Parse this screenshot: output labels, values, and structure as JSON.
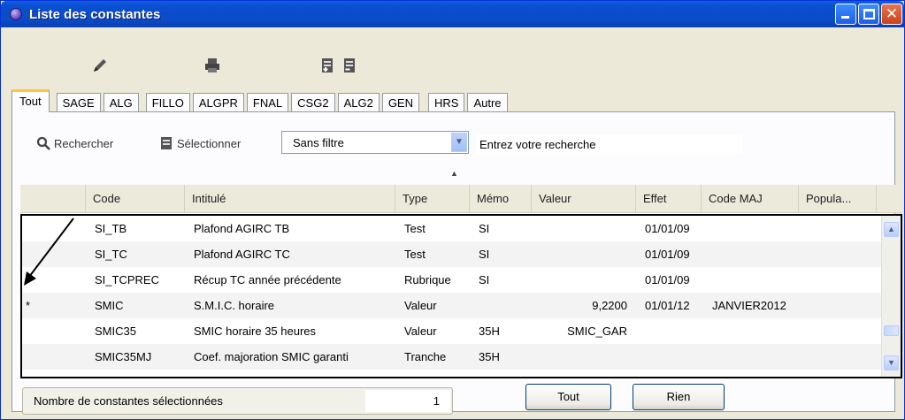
{
  "window": {
    "title": "Liste des constantes",
    "buttons": {
      "minimize": "minimize-icon",
      "maximize": "maximize-icon",
      "close": "✕"
    }
  },
  "toolbar": {
    "icons": [
      "pencil-icon",
      "printer-icon",
      "add-document-icon",
      "remove-document-icon"
    ]
  },
  "tabs": [
    "Tout",
    "SAGE",
    "ALG",
    "FILLO",
    "ALGPR",
    "FNAL",
    "CSG2",
    "ALG2",
    "GEN",
    "HRS",
    "Autre"
  ],
  "search": {
    "rechercher_label": "Rechercher",
    "selectionner_label": "Sélectionner",
    "filter_value": "Sans filtre",
    "input_value": "Entrez votre recherche"
  },
  "grid": {
    "columns": [
      "Code",
      "Intitulé",
      "Type",
      "Mémo",
      "Valeur",
      "Effet",
      "Code MAJ",
      "Popula..."
    ],
    "rows": [
      {
        "marker": "",
        "code": "SI_TB",
        "intitule": "Plafond AGIRC TB",
        "type": "Test",
        "memo": "SI",
        "valeur": "",
        "effet": "01/01/09",
        "code_maj": ""
      },
      {
        "marker": "",
        "code": "SI_TC",
        "intitule": "Plafond AGIRC TC",
        "type": "Test",
        "memo": "SI",
        "valeur": "",
        "effet": "01/01/09",
        "code_maj": ""
      },
      {
        "marker": "",
        "code": "SI_TCPREC",
        "intitule": "Récup TC année précédente",
        "type": "Rubrique",
        "memo": "SI",
        "valeur": "",
        "effet": "01/01/09",
        "code_maj": ""
      },
      {
        "marker": "*",
        "code": "SMIC",
        "intitule": "S.M.I.C. horaire",
        "type": "Valeur",
        "memo": "",
        "valeur": "9,2200",
        "effet": "01/01/12",
        "code_maj": "JANVIER2012"
      },
      {
        "marker": "",
        "code": "SMIC35",
        "intitule": "SMIC horaire 35 heures",
        "type": "Valeur",
        "memo": "35H",
        "valeur": "SMIC_GAR",
        "effet": "",
        "code_maj": ""
      },
      {
        "marker": "",
        "code": "SMIC35MJ",
        "intitule": "Coef. majoration SMIC garanti",
        "type": "Tranche",
        "memo": "35H",
        "valeur": "",
        "effet": "",
        "code_maj": ""
      }
    ]
  },
  "status": {
    "label": "Nombre de constantes sélectionnées",
    "count": "1"
  },
  "buttons": {
    "tout": "Tout",
    "rien": "Rien"
  }
}
